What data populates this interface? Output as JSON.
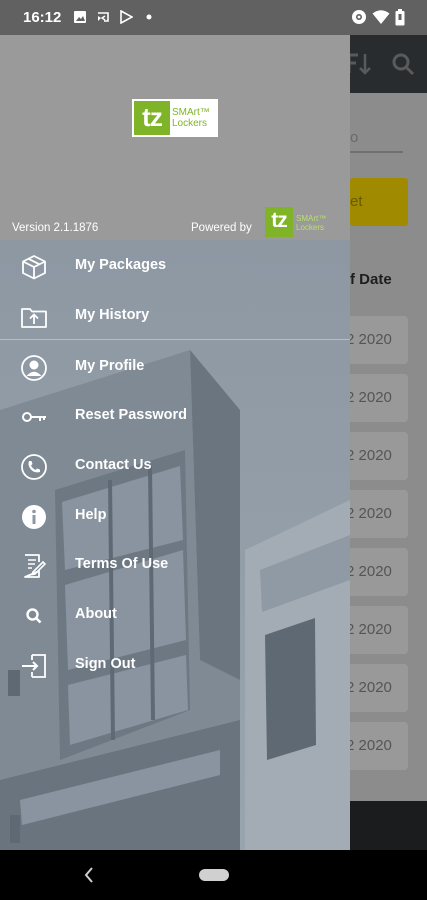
{
  "status_bar": {
    "time": "16:12",
    "left_icons": [
      "image-icon",
      "cast-icon",
      "play-store-icon",
      "dot-icon"
    ],
    "right_icons": [
      "vpn-icon",
      "wifi-icon",
      "battery-icon"
    ]
  },
  "background": {
    "toolbar_icons": [
      "sort-icon",
      "search-icon"
    ],
    "search_text": "o",
    "button_text": "et",
    "column_header": "ff Date",
    "rows": [
      "2 2020",
      "2 2020",
      "2 2020",
      "2 2020",
      "2 2020",
      "2 2020",
      "2 2020",
      "2 2020"
    ]
  },
  "drawer": {
    "logo": {
      "mark": "tz",
      "line1": "SMArt™",
      "line2": "Lockers"
    },
    "version": "Version 2.1.1876",
    "powered_by": "Powered by",
    "small_logo": {
      "mark": "tz",
      "line1": "SMArt™",
      "line2": "Lockers"
    },
    "menu": [
      {
        "label": "My Packages",
        "icon": "package-icon"
      },
      {
        "label": "My History",
        "icon": "folder-upload-icon"
      },
      {
        "label": "My Profile",
        "icon": "profile-icon"
      },
      {
        "label": "Reset Password",
        "icon": "key-icon"
      },
      {
        "label": "Contact Us",
        "icon": "phone-icon"
      },
      {
        "label": "Help",
        "icon": "info-icon"
      },
      {
        "label": "Terms Of Use",
        "icon": "document-edit-icon"
      },
      {
        "label": "About",
        "icon": "search-icon"
      },
      {
        "label": "Sign Out",
        "icon": "sign-out-icon"
      }
    ]
  },
  "colors": {
    "brand_green": "#7fb428",
    "accent_yellow": "#f2cc00",
    "toolbar_dark": "#292c2f"
  }
}
